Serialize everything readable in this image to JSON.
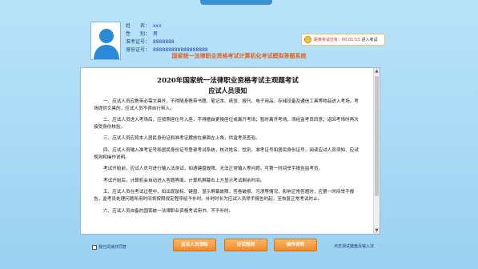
{
  "candidate": {
    "name_label": "姓　　名：",
    "name_value": "xxx",
    "gender_label": "性　　别：",
    "gender_value": "男",
    "admission_label": "准考证号：",
    "admission_value": "8888888",
    "id_label": "身份证号：",
    "id_value": "888888888888888888"
  },
  "timer": {
    "label": "距离考试还有：",
    "time": "00:01:53",
    "enter": "进入考试"
  },
  "banner": "国家统一法律职业资格考试计算机化考试模拟答题系统",
  "document": {
    "title": "2020年国家统一法律职业资格考试主观题考试",
    "subtitle": "应试人员须知",
    "paragraphs": [
      "一、应试人员应携带必需文具外，不得随身携带书籍、笔记本、纸张、报刊、电子用品、存储设备及通信工具等物品进入考场。考场提供文具的，应试人员不得自行带入。",
      "二、应试人员进入考场后，应按照座位号入座，不得擅自更换座位或离开考场；暂时离开考场，须经监考员同意；返回考场时再次接受身份核验。",
      "三、应试人员应将本人居民身份证和准考证摆放在桌面左上角，供监考员查验。",
      "四、应试人员输入准考证号和居民身份证号登录考试系统，核对姓名、性别、准考证号和居民身份证号，阅读应试人员须知、应试规则和操作说明。",
      "考试开始前，应试人员可进行输入法测试，如遇键盘故障、无法正常输入等问题，可第一时间举手报告监考员。",
      "考试开始后，计算机会自动进入答题界面。计算机屏幕右上方显示考试剩余时间。",
      "五、应试人员在考试过程中，如出现鼠标、键盘、显示屏幕故障，答卷破损、污渍等情况，影响正常答题时，应第一时间举手报告，监考员处理问题所用时间将按照规定程序给予补时。补时时长为应试人员举手报告时起，至恢复正常考试时止。",
      "六、应试人员自备的国家统一法律职业资格考试用书、不予补时。"
    ]
  },
  "agree_label": "我已阅读并同意",
  "buttons": {
    "notice": "应试人员须知",
    "rules": "应试规则",
    "instructions": "操作说明"
  },
  "foot_note": "点击测试键盘及输入法"
}
